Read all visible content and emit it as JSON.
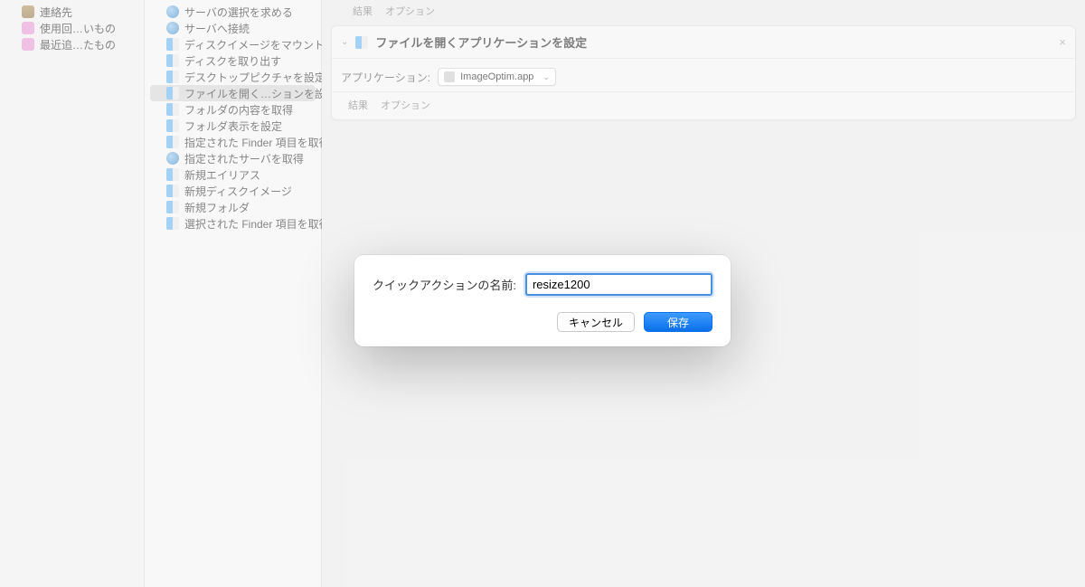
{
  "sidebar1": {
    "items": [
      {
        "label": "連絡先",
        "icon": "ic-folder-brown"
      },
      {
        "label": "使用回…いもの",
        "icon": "ic-folder-pink"
      },
      {
        "label": "最近追…たもの",
        "icon": "ic-folder-pink"
      }
    ]
  },
  "sidebar2": {
    "items": [
      {
        "label": "サーバの選択を求める",
        "icon": "ic-globe"
      },
      {
        "label": "サーバへ接続",
        "icon": "ic-globe"
      },
      {
        "label": "ディスクイメージをマウント",
        "icon": "ic-finder"
      },
      {
        "label": "ディスクを取り出す",
        "icon": "ic-finder"
      },
      {
        "label": "デスクトップピクチャを設定",
        "icon": "ic-finder"
      },
      {
        "label": "ファイルを開く…ションを設定",
        "icon": "ic-finder",
        "selected": true
      },
      {
        "label": "フォルダの内容を取得",
        "icon": "ic-finder"
      },
      {
        "label": "フォルダ表示を設定",
        "icon": "ic-finder"
      },
      {
        "label": "指定された Finder 項目を取得",
        "icon": "ic-finder"
      },
      {
        "label": "指定されたサーバを取得",
        "icon": "ic-globe"
      },
      {
        "label": "新規エイリアス",
        "icon": "ic-finder"
      },
      {
        "label": "新規ディスクイメージ",
        "icon": "ic-finder"
      },
      {
        "label": "新規フォルダ",
        "icon": "ic-finder"
      },
      {
        "label": "選択された Finder 項目を取得",
        "icon": "ic-finder"
      }
    ]
  },
  "main": {
    "tabs": {
      "results": "結果",
      "options": "オプション"
    },
    "card": {
      "title": "ファイルを開くアプリケーションを設定",
      "app_label": "アプリケーション:",
      "app_value": "ImageOptim.app",
      "foot_results": "結果",
      "foot_options": "オプション"
    }
  },
  "dialog": {
    "name_label": "クイックアクションの名前:",
    "name_value": "resize1200",
    "cancel": "キャンセル",
    "save": "保存"
  }
}
